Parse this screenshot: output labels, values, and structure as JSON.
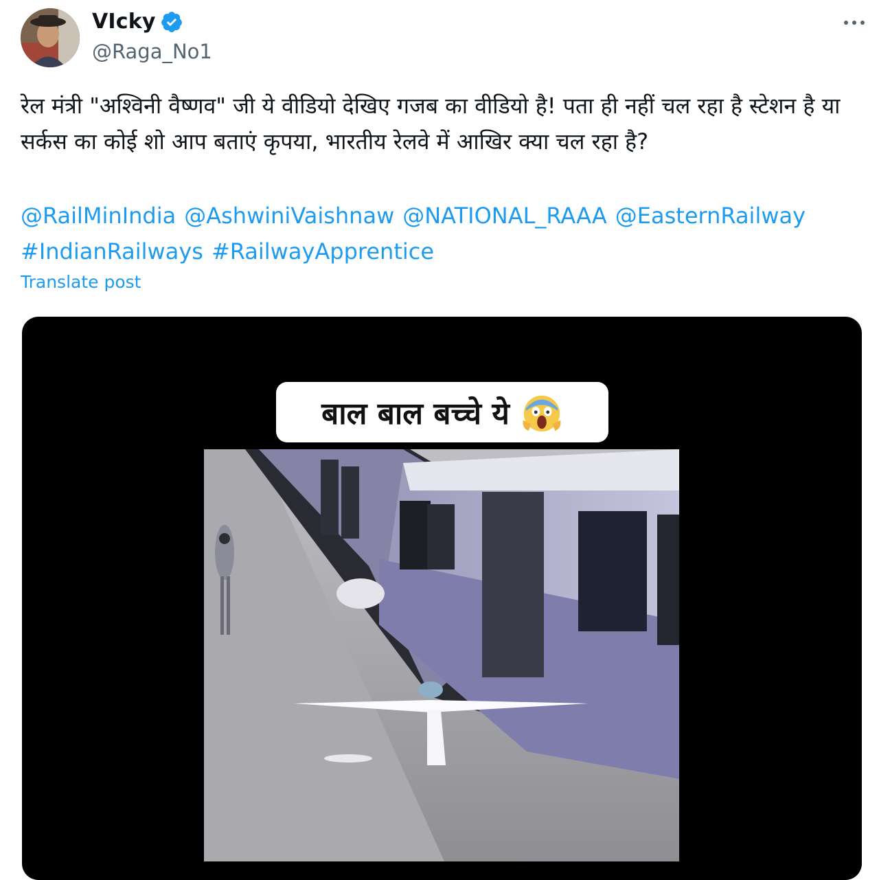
{
  "author": {
    "display_name": "VIcky",
    "handle": "@Raga_No1"
  },
  "tweet": {
    "text": "रेल मंत्री \"अश्विनी वैष्णव\" जी ये वीडियो देखिए गजब का वीडियो है! पता ही नहीं चल रहा है स्टेशन है या सर्कस का कोई शो आप बताएं कृपया, भारतीय रेलवे में आखिर क्या चल रहा है?",
    "mentions": [
      "@RailMinIndia",
      "@AshwiniVaishnaw",
      "@NATIONAL_RAAA",
      "@EasternRailway",
      "#IndianRailways",
      "#RailwayApprentice"
    ],
    "translate_label": "Translate post"
  },
  "media": {
    "caption": "बाल बाल बच्चे ये",
    "emoji": "scream-emoji"
  },
  "colors": {
    "link": "#1d9bf0",
    "secondary_text": "#536471",
    "verified": "#1d9bf0"
  },
  "icons": {
    "verified": "verified-badge-icon",
    "more": "more-icon"
  }
}
